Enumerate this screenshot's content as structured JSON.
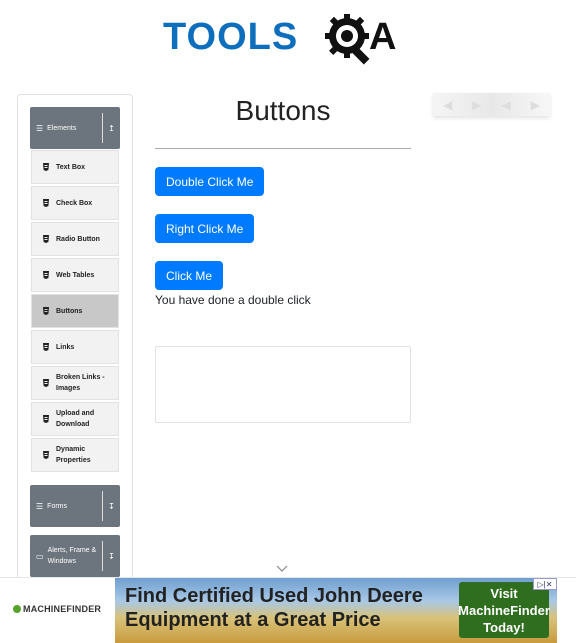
{
  "logo": {
    "text": "TOOLS",
    "suffix": "A"
  },
  "sidebar": {
    "groups": [
      {
        "label": "Elements",
        "icon": "list-icon",
        "toggle": "collapse-arrow-icon"
      },
      {
        "label": "Forms",
        "icon": "list-icon",
        "toggle": "expand-arrow-icon"
      },
      {
        "label": "Alerts, Frame & Windows",
        "icon": "window-icon",
        "toggle": "expand-arrow-icon"
      }
    ],
    "items": [
      {
        "label": "Text Box"
      },
      {
        "label": "Check Box"
      },
      {
        "label": "Radio Button"
      },
      {
        "label": "Web Tables"
      },
      {
        "label": "Buttons",
        "active": true
      },
      {
        "label": "Links"
      },
      {
        "label": "Broken Links - Images"
      },
      {
        "label": "Upload and Download"
      },
      {
        "label": "Dynamic Properties"
      }
    ]
  },
  "main": {
    "title": "Buttons",
    "buttons": {
      "double_click": "Double Click Me",
      "right_click": "Right Click Me",
      "click": "Click Me"
    },
    "message": "You have done a double click"
  },
  "banner": {
    "brand": "MACHINEFINDER",
    "headline": "Find Certified Used John Deere Equipment at a Great Price",
    "cta": "Visit MachineFinder Today!",
    "close": "▷|✕"
  },
  "colors": {
    "primary": "#007bff",
    "logo_blue": "#0d6ebd",
    "sidebar_header": "#6c757d",
    "active_item": "#c8c8c8"
  }
}
